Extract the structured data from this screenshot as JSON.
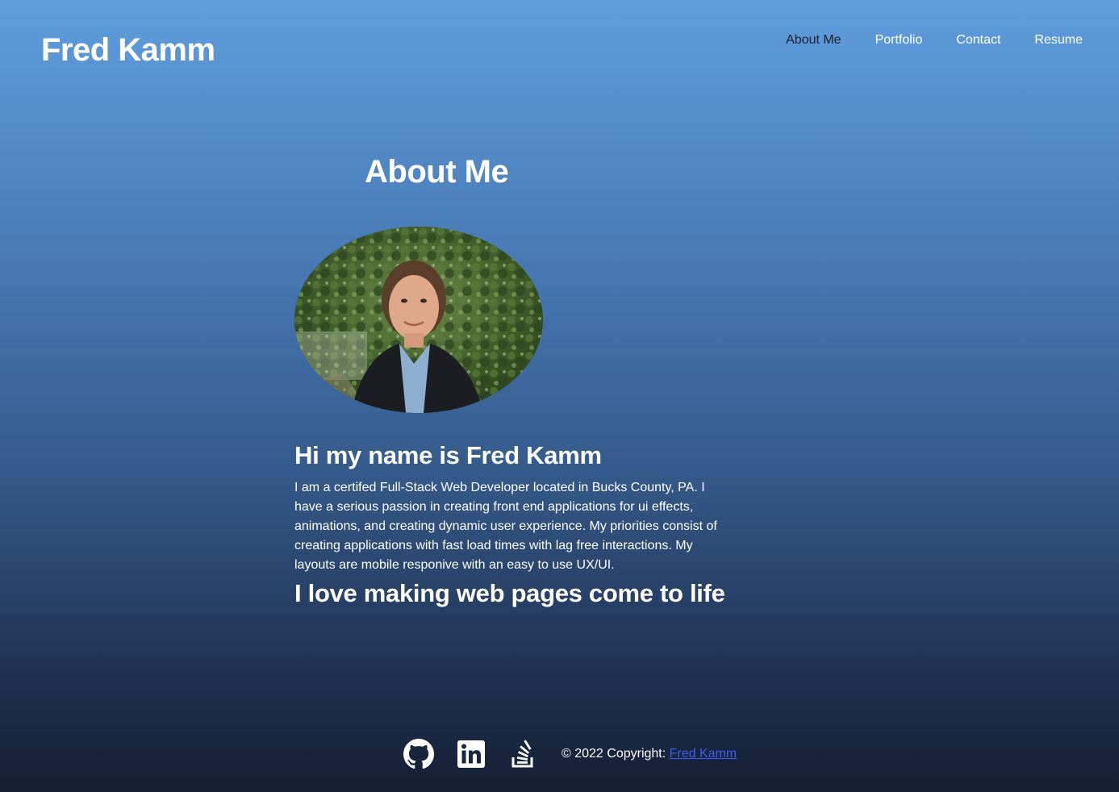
{
  "header": {
    "site_title": "Fred Kamm",
    "nav": [
      {
        "label": "About Me",
        "active": true
      },
      {
        "label": "Portfolio",
        "active": false
      },
      {
        "label": "Contact",
        "active": false
      },
      {
        "label": "Resume",
        "active": false
      }
    ]
  },
  "main": {
    "heading": "About Me",
    "intro_heading": "Hi my name is Fred Kamm",
    "bio": "I am a certifed Full-Stack Web Developer located in Bucks County, PA. I have a serious passion in creating front end applications for ui effects, animations, and creating dynamic user experience. My priorities consist of creating applications with fast load times with lag free interactions. My layouts are mobile responive with an easy to use UX/UI.",
    "tagline": "I love making web pages come to life"
  },
  "footer": {
    "icons": [
      "github-icon",
      "linkedin-icon",
      "stackoverflow-icon"
    ],
    "copyright_prefix": "© 2022 Copyright: ",
    "copyright_link": "Fred Kamm"
  },
  "colors": {
    "active_nav": "#1b1f2a",
    "link": "#3a5ef5"
  }
}
